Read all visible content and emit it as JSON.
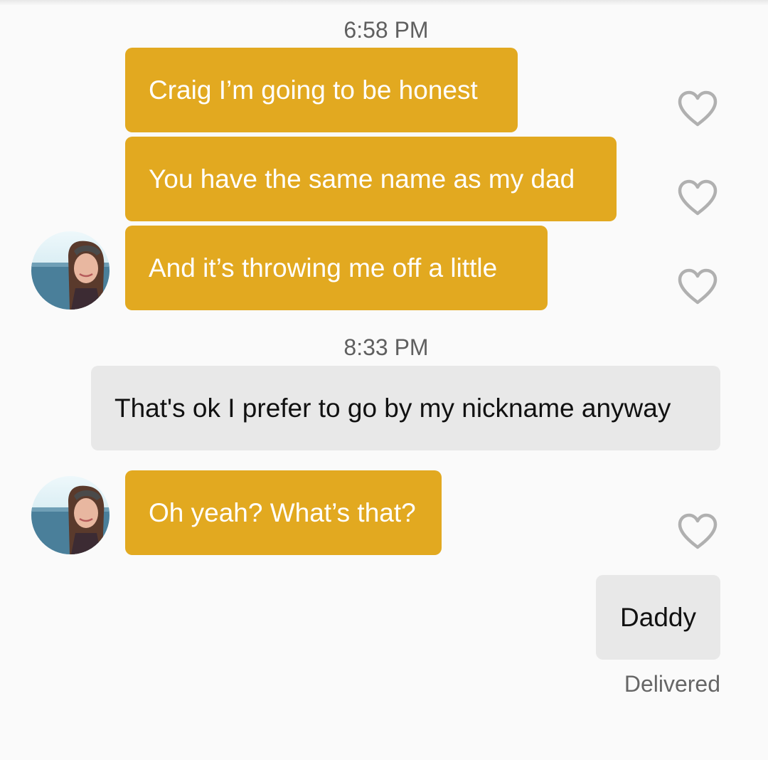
{
  "conversation": {
    "timestamps": [
      "6:58 PM",
      "8:33 PM"
    ],
    "messages": [
      {
        "sender": "match",
        "text": "Craig I’m going to be honest",
        "liked": false
      },
      {
        "sender": "match",
        "text": "You have the same name as my dad",
        "liked": false
      },
      {
        "sender": "match",
        "text": "And it’s throwing me off a little",
        "liked": false
      },
      {
        "sender": "me",
        "text": "That's ok I prefer to go by my nickname anyway"
      },
      {
        "sender": "match",
        "text": "Oh yeah? What’s that?",
        "liked": false
      },
      {
        "sender": "me",
        "text": "Daddy"
      }
    ],
    "status": "Delivered"
  },
  "icons": {
    "like": "heart-outline-icon",
    "avatar": "profile-photo"
  },
  "colors": {
    "incoming_bubble": "#e2a920",
    "outgoing_bubble": "#e8e8e8",
    "background": "#fafafa",
    "heart_stroke": "#b0b0b0"
  }
}
